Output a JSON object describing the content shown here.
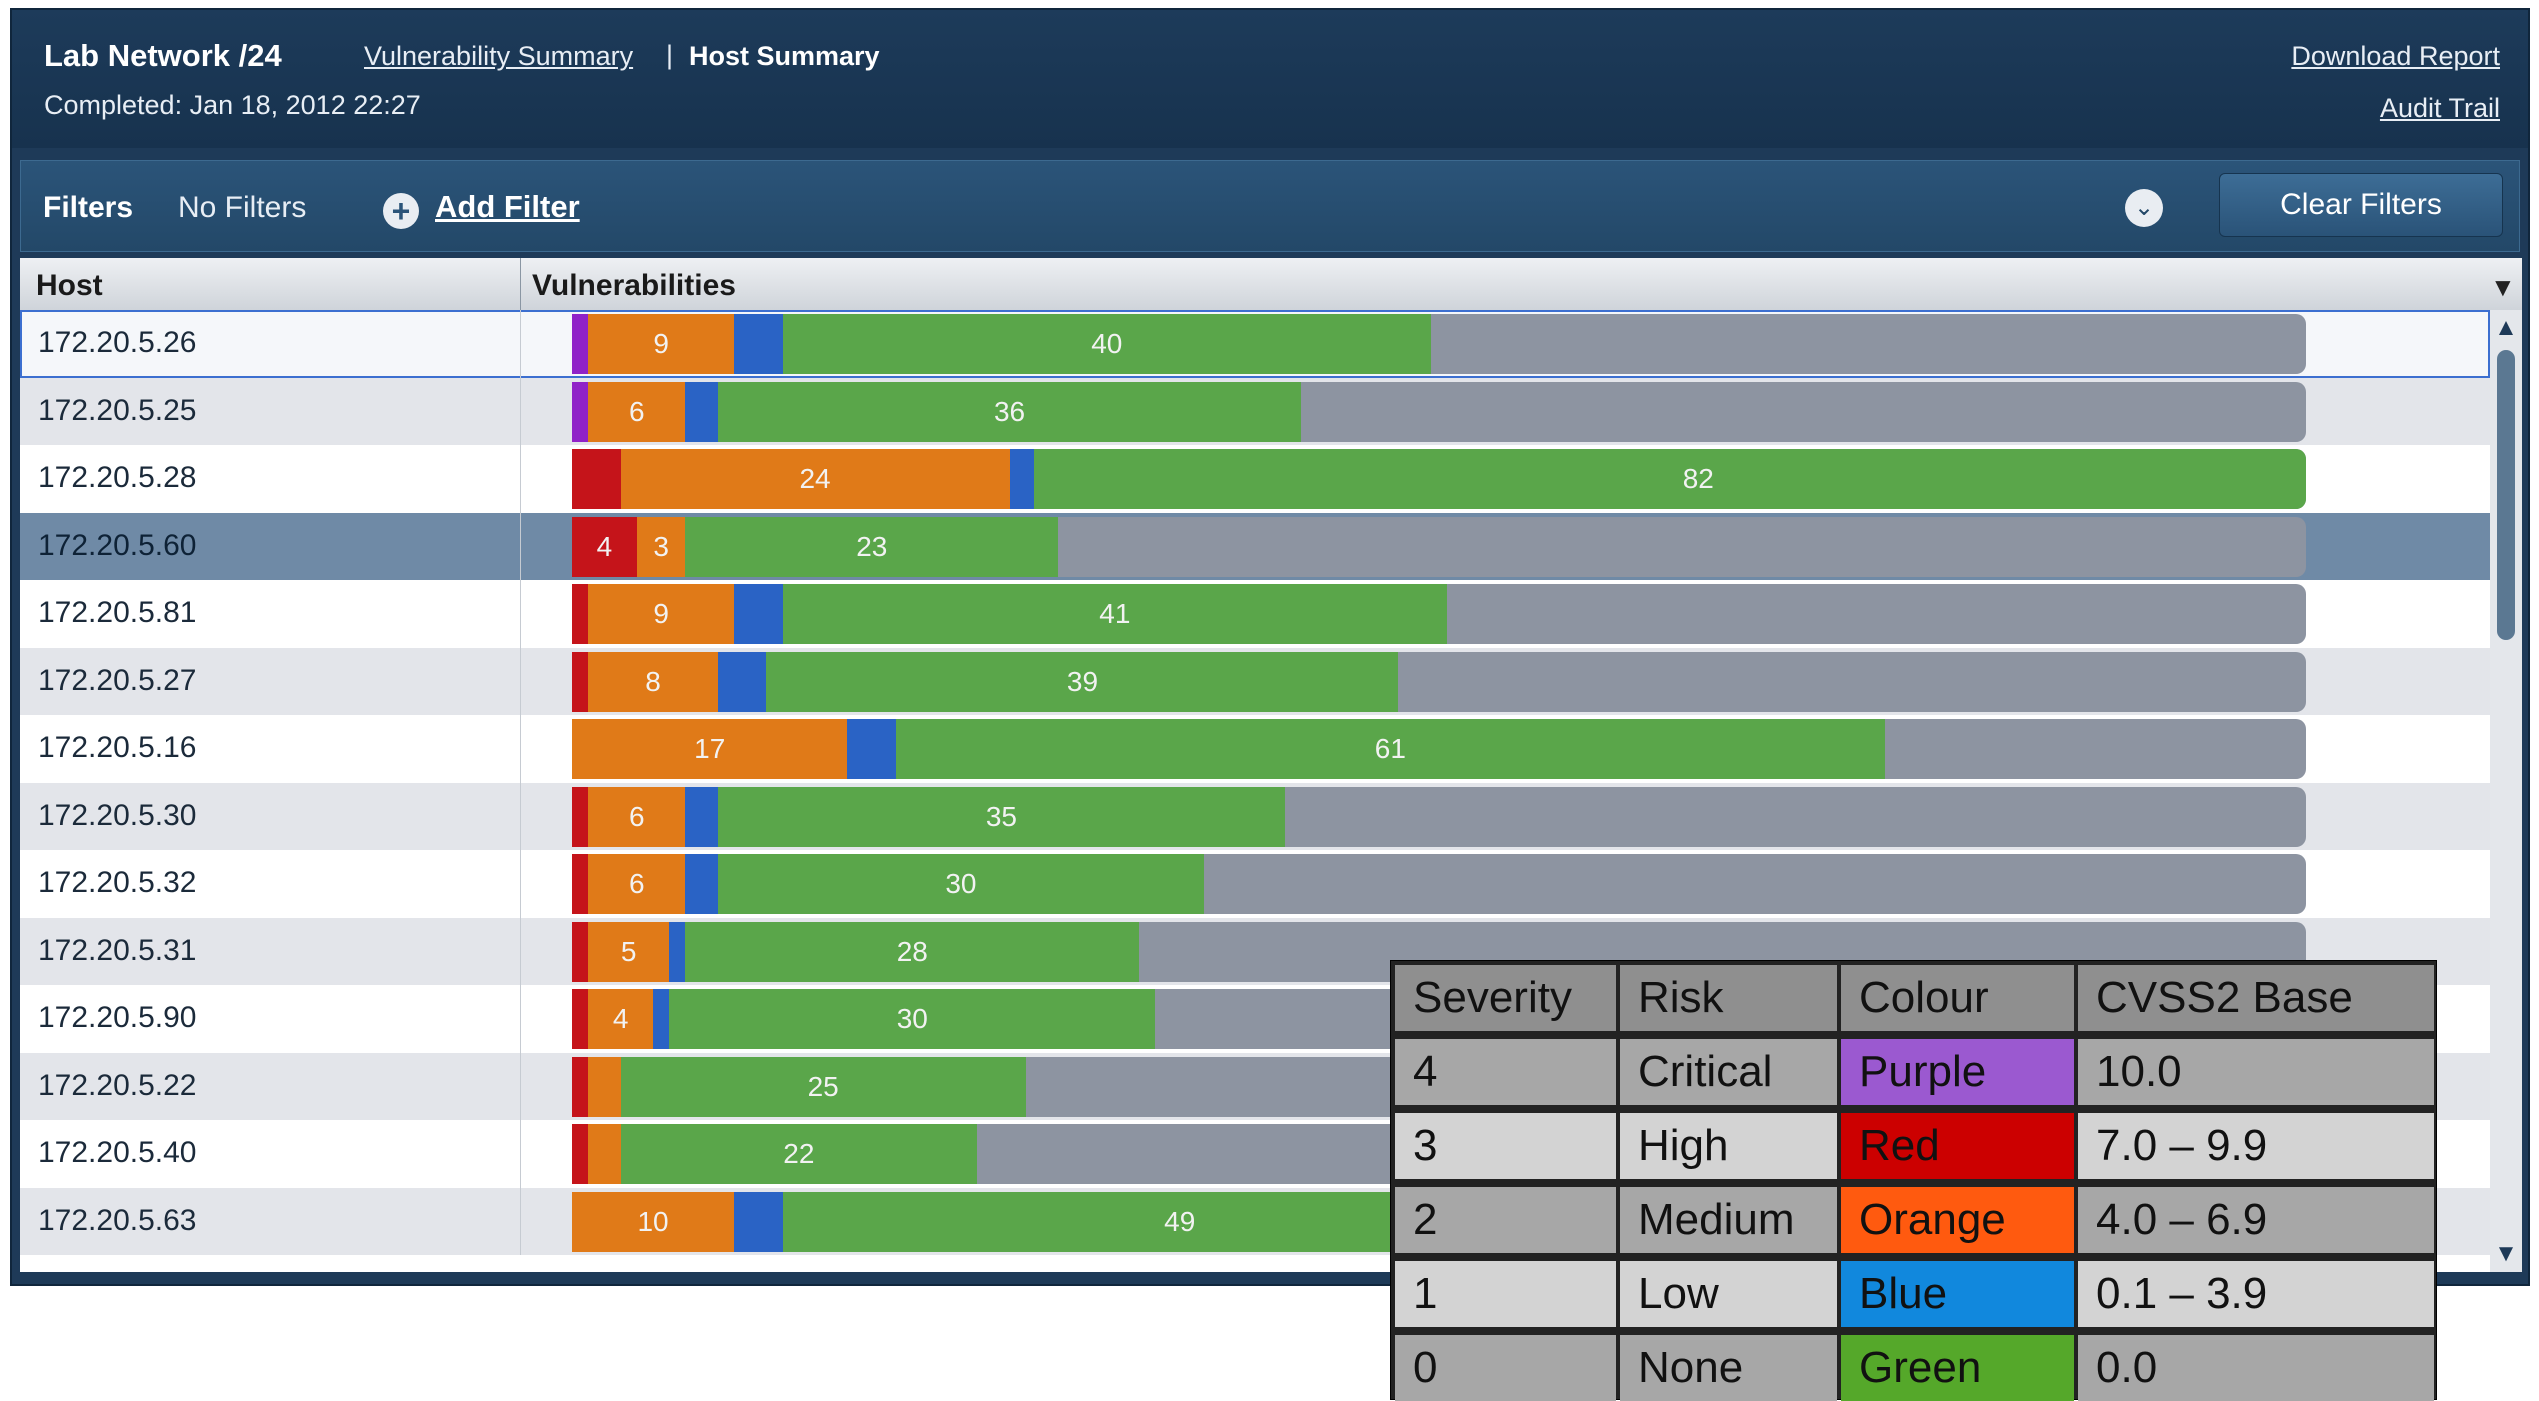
{
  "header": {
    "title": "Lab Network /24",
    "vuln_summary_link": "Vulnerability Summary",
    "separator": "|",
    "host_summary": "Host Summary",
    "completed": "Completed: Jan 18, 2012 22:27",
    "download_report": "Download Report",
    "audit_trail": "Audit Trail"
  },
  "filters": {
    "label": "Filters",
    "status": "No Filters",
    "add_icon": "plus-circle-icon",
    "add_label": "Add Filter",
    "collapse_icon": "chevron-down-circle-icon",
    "clear_label": "Clear Filters"
  },
  "table": {
    "col_host": "Host",
    "col_vulns": "Vulnerabilities",
    "sort_icon": "triangle-down-icon",
    "max_total": 107,
    "colors": {
      "critical": "#9022c8",
      "high": "#c5141a",
      "medium": "#e07a18",
      "low": "#2a63c5",
      "none": "#5aa64a",
      "track": "#8d94a1"
    },
    "rows": [
      {
        "host": "172.20.5.26",
        "critical": 1,
        "high": 0,
        "medium": 9,
        "low": 3,
        "none": 40,
        "label_high": "",
        "label_medium": "9",
        "label_none": "40",
        "state": "selected"
      },
      {
        "host": "172.20.5.25",
        "critical": 1,
        "high": 0,
        "medium": 6,
        "low": 2,
        "none": 36,
        "label_high": "",
        "label_medium": "6",
        "label_none": "36",
        "state": ""
      },
      {
        "host": "172.20.5.28",
        "critical": 0,
        "high": 3,
        "medium": 24,
        "low": 1.5,
        "none": 82,
        "label_high": "",
        "label_medium": "24",
        "label_none": "82",
        "state": ""
      },
      {
        "host": "172.20.5.60",
        "critical": 0,
        "high": 4,
        "medium": 3,
        "low": 0,
        "none": 23,
        "label_high": "4",
        "label_medium": "3",
        "label_none": "23",
        "state": "highlighted"
      },
      {
        "host": "172.20.5.81",
        "critical": 0,
        "high": 1,
        "medium": 9,
        "low": 3,
        "none": 41,
        "label_high": "",
        "label_medium": "9",
        "label_none": "41",
        "state": ""
      },
      {
        "host": "172.20.5.27",
        "critical": 0,
        "high": 1,
        "medium": 8,
        "low": 3,
        "none": 39,
        "label_high": "",
        "label_medium": "8",
        "label_none": "39",
        "state": ""
      },
      {
        "host": "172.20.5.16",
        "critical": 0,
        "high": 0,
        "medium": 17,
        "low": 3,
        "none": 61,
        "label_high": "",
        "label_medium": "17",
        "label_none": "61",
        "state": ""
      },
      {
        "host": "172.20.5.30",
        "critical": 0,
        "high": 1,
        "medium": 6,
        "low": 2,
        "none": 35,
        "label_high": "",
        "label_medium": "6",
        "label_none": "35",
        "state": ""
      },
      {
        "host": "172.20.5.32",
        "critical": 0,
        "high": 1,
        "medium": 6,
        "low": 2,
        "none": 30,
        "label_high": "",
        "label_medium": "6",
        "label_none": "30",
        "state": ""
      },
      {
        "host": "172.20.5.31",
        "critical": 0,
        "high": 1,
        "medium": 5,
        "low": 1,
        "none": 28,
        "label_high": "",
        "label_medium": "5",
        "label_none": "28",
        "state": ""
      },
      {
        "host": "172.20.5.90",
        "critical": 0,
        "high": 1,
        "medium": 4,
        "low": 1,
        "none": 30,
        "label_high": "",
        "label_medium": "4",
        "label_none": "30",
        "state": ""
      },
      {
        "host": "172.20.5.22",
        "critical": 0,
        "high": 1,
        "medium": 2,
        "low": 0,
        "none": 25,
        "label_high": "",
        "label_medium": "",
        "label_none": "25",
        "state": ""
      },
      {
        "host": "172.20.5.40",
        "critical": 0,
        "high": 1,
        "medium": 2,
        "low": 0,
        "none": 22,
        "label_high": "",
        "label_medium": "",
        "label_none": "22",
        "state": ""
      },
      {
        "host": "172.20.5.63",
        "critical": 0,
        "high": 0,
        "medium": 10,
        "low": 3,
        "none": 49,
        "label_high": "",
        "label_medium": "10",
        "label_none": "49",
        "state": ""
      }
    ]
  },
  "scrollbar": {
    "up_icon": "scroll-up-arrow-icon",
    "down_icon": "scroll-down-arrow-icon"
  },
  "legend": {
    "headers": [
      "Severity",
      "Risk",
      "Colour",
      "CVSS2 Base"
    ],
    "rows": [
      {
        "severity": "4",
        "risk": "Critical",
        "colour": "Purple",
        "cvss": "10.0",
        "swatch": "#9b59d0"
      },
      {
        "severity": "3",
        "risk": "High",
        "colour": "Red",
        "cvss": "7.0 – 9.9",
        "swatch": "#cc0000"
      },
      {
        "severity": "2",
        "risk": "Medium",
        "colour": "Orange",
        "cvss": "4.0 – 6.9",
        "swatch": "#ff5a0f"
      },
      {
        "severity": "1",
        "risk": "Low",
        "colour": "Blue",
        "cvss": "0.1 – 3.9",
        "swatch": "#1188dd"
      },
      {
        "severity": "0",
        "risk": "None",
        "colour": "Green",
        "cvss": "0.0",
        "swatch": "#55a82a"
      }
    ]
  }
}
